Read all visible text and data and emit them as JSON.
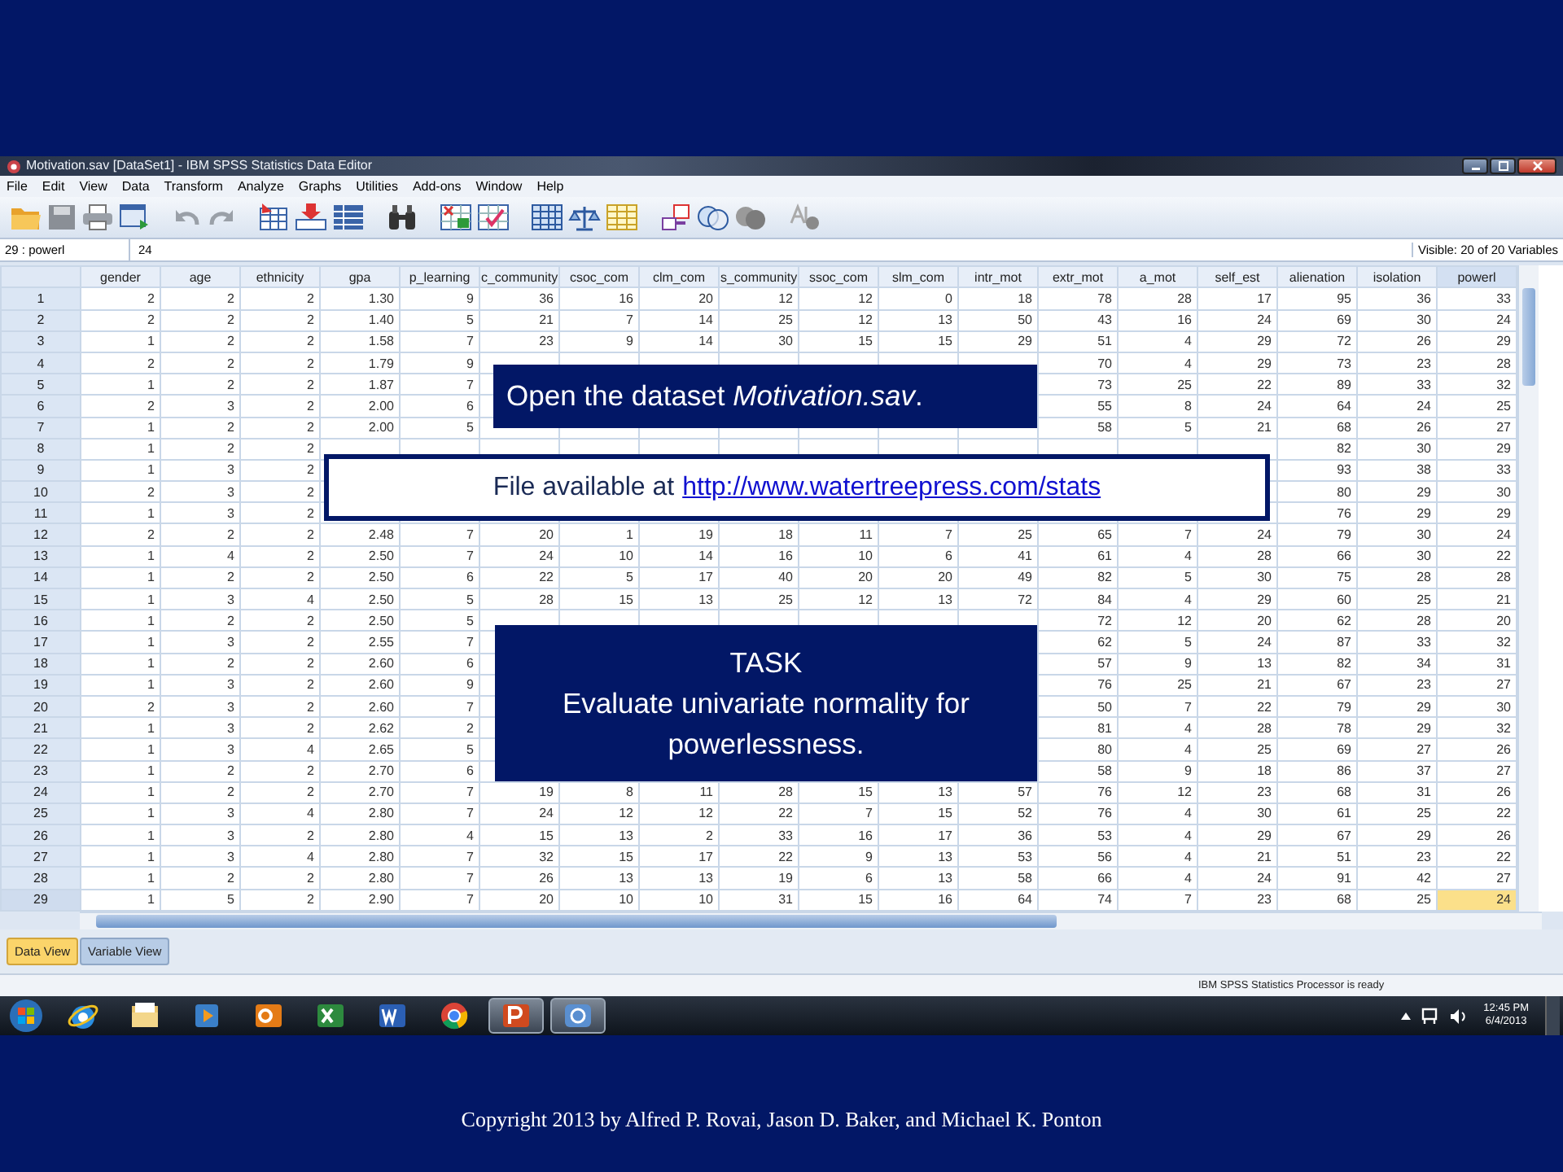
{
  "window": {
    "title": "Motivation.sav [DataSet1] - IBM SPSS Statistics Data Editor"
  },
  "menu": [
    "File",
    "Edit",
    "View",
    "Data",
    "Transform",
    "Analyze",
    "Graphs",
    "Utilities",
    "Add-ons",
    "Window",
    "Help"
  ],
  "cell_editor": {
    "cell": "29 : powerl",
    "value": "24",
    "visible": "Visible: 20 of 20 Variables"
  },
  "table": {
    "columns": [
      {
        "name": "gender",
        "selected": false
      },
      {
        "name": "age",
        "selected": false
      },
      {
        "name": "ethnicity",
        "selected": false
      },
      {
        "name": "gpa",
        "selected": false
      },
      {
        "name": "p_learning",
        "selected": false
      },
      {
        "name": "c_community",
        "selected": false
      },
      {
        "name": "csoc_com",
        "selected": false
      },
      {
        "name": "clm_com",
        "selected": false
      },
      {
        "name": "s_community",
        "selected": false
      },
      {
        "name": "ssoc_com",
        "selected": false
      },
      {
        "name": "slm_com",
        "selected": false
      },
      {
        "name": "intr_mot",
        "selected": false
      },
      {
        "name": "extr_mot",
        "selected": false
      },
      {
        "name": "a_mot",
        "selected": false
      },
      {
        "name": "self_est",
        "selected": false
      },
      {
        "name": "alienation",
        "selected": false
      },
      {
        "name": "isolation",
        "selected": false
      },
      {
        "name": "powerl",
        "selected": true
      }
    ],
    "rows": [
      {
        "number": "1",
        "selected": false,
        "cells": [
          "2",
          "2",
          "2",
          "1.30",
          "9",
          "36",
          "16",
          "20",
          "12",
          "12",
          "0",
          "18",
          "78",
          "28",
          "17",
          "95",
          "36",
          "33"
        ]
      },
      {
        "number": "2",
        "selected": false,
        "cells": [
          "2",
          "2",
          "2",
          "1.40",
          "5",
          "21",
          "7",
          "14",
          "25",
          "12",
          "13",
          "50",
          "43",
          "16",
          "24",
          "69",
          "30",
          "24"
        ]
      },
      {
        "number": "3",
        "selected": false,
        "cells": [
          "1",
          "2",
          "2",
          "1.58",
          "7",
          "23",
          "9",
          "14",
          "30",
          "15",
          "15",
          "29",
          "51",
          "4",
          "29",
          "72",
          "26",
          "29"
        ]
      },
      {
        "number": "4",
        "selected": false,
        "cells": [
          "2",
          "2",
          "2",
          "1.79",
          "9",
          null,
          null,
          null,
          null,
          null,
          null,
          null,
          "70",
          "4",
          "29",
          "73",
          "23",
          "28"
        ]
      },
      {
        "number": "5",
        "selected": false,
        "cells": [
          "1",
          "2",
          "2",
          "1.87",
          "7",
          null,
          null,
          null,
          null,
          null,
          null,
          null,
          "73",
          "25",
          "22",
          "89",
          "33",
          "32"
        ]
      },
      {
        "number": "6",
        "selected": false,
        "cells": [
          "2",
          "3",
          "2",
          "2.00",
          "6",
          null,
          null,
          null,
          null,
          null,
          null,
          null,
          "55",
          "8",
          "24",
          "64",
          "24",
          "25"
        ]
      },
      {
        "number": "7",
        "selected": false,
        "cells": [
          "1",
          "2",
          "2",
          "2.00",
          "5",
          null,
          null,
          null,
          null,
          null,
          null,
          null,
          "58",
          "5",
          "21",
          "68",
          "26",
          "27"
        ]
      },
      {
        "number": "8",
        "selected": false,
        "cells": [
          "1",
          "2",
          "2",
          null,
          null,
          null,
          null,
          null,
          null,
          null,
          null,
          null,
          null,
          null,
          null,
          "82",
          "30",
          "29"
        ]
      },
      {
        "number": "9",
        "selected": false,
        "cells": [
          "1",
          "3",
          "2",
          null,
          null,
          null,
          null,
          null,
          null,
          null,
          null,
          null,
          null,
          null,
          null,
          "93",
          "38",
          "33"
        ]
      },
      {
        "number": "10",
        "selected": false,
        "cells": [
          "2",
          "3",
          "2",
          null,
          null,
          null,
          null,
          null,
          null,
          null,
          null,
          null,
          null,
          null,
          null,
          "80",
          "29",
          "30"
        ]
      },
      {
        "number": "11",
        "selected": false,
        "cells": [
          "1",
          "3",
          "2",
          null,
          null,
          null,
          null,
          null,
          null,
          null,
          null,
          null,
          null,
          null,
          null,
          "76",
          "29",
          "29"
        ]
      },
      {
        "number": "12",
        "selected": false,
        "cells": [
          "2",
          "2",
          "2",
          "2.48",
          "7",
          "20",
          "1",
          "19",
          "18",
          "11",
          "7",
          "25",
          "65",
          "7",
          "24",
          "79",
          "30",
          "24"
        ]
      },
      {
        "number": "13",
        "selected": false,
        "cells": [
          "1",
          "4",
          "2",
          "2.50",
          "7",
          "24",
          "10",
          "14",
          "16",
          "10",
          "6",
          "41",
          "61",
          "4",
          "28",
          "66",
          "30",
          "22"
        ]
      },
      {
        "number": "14",
        "selected": false,
        "cells": [
          "1",
          "2",
          "2",
          "2.50",
          "6",
          "22",
          "5",
          "17",
          "40",
          "20",
          "20",
          "49",
          "82",
          "5",
          "30",
          "75",
          "28",
          "28"
        ]
      },
      {
        "number": "15",
        "selected": false,
        "cells": [
          "1",
          "3",
          "4",
          "2.50",
          "5",
          "28",
          "15",
          "13",
          "25",
          "12",
          "13",
          "72",
          "84",
          "4",
          "29",
          "60",
          "25",
          "21"
        ]
      },
      {
        "number": "16",
        "selected": false,
        "cells": [
          "1",
          "2",
          "2",
          "2.50",
          "5",
          null,
          null,
          null,
          null,
          null,
          null,
          null,
          "72",
          "12",
          "20",
          "62",
          "28",
          "20"
        ]
      },
      {
        "number": "17",
        "selected": false,
        "cells": [
          "1",
          "3",
          "2",
          "2.55",
          "7",
          null,
          null,
          null,
          null,
          null,
          null,
          null,
          "62",
          "5",
          "24",
          "87",
          "33",
          "32"
        ]
      },
      {
        "number": "18",
        "selected": false,
        "cells": [
          "1",
          "2",
          "2",
          "2.60",
          "6",
          null,
          null,
          null,
          null,
          null,
          null,
          null,
          "57",
          "9",
          "13",
          "82",
          "34",
          "31"
        ]
      },
      {
        "number": "19",
        "selected": false,
        "cells": [
          "1",
          "3",
          "2",
          "2.60",
          "9",
          null,
          null,
          null,
          null,
          null,
          null,
          null,
          "76",
          "25",
          "21",
          "67",
          "23",
          "27"
        ]
      },
      {
        "number": "20",
        "selected": false,
        "cells": [
          "2",
          "3",
          "2",
          "2.60",
          "7",
          null,
          null,
          null,
          null,
          null,
          null,
          null,
          "50",
          "7",
          "22",
          "79",
          "29",
          "30"
        ]
      },
      {
        "number": "21",
        "selected": false,
        "cells": [
          "1",
          "3",
          "2",
          "2.62",
          "2",
          null,
          null,
          null,
          null,
          null,
          null,
          null,
          "81",
          "4",
          "28",
          "78",
          "29",
          "32"
        ]
      },
      {
        "number": "22",
        "selected": false,
        "cells": [
          "1",
          "3",
          "4",
          "2.65",
          "5",
          null,
          null,
          null,
          null,
          null,
          null,
          null,
          "80",
          "4",
          "25",
          "69",
          "27",
          "26"
        ]
      },
      {
        "number": "23",
        "selected": false,
        "cells": [
          "1",
          "2",
          "2",
          "2.70",
          "6",
          null,
          null,
          null,
          null,
          null,
          null,
          null,
          "58",
          "9",
          "18",
          "86",
          "37",
          "27"
        ]
      },
      {
        "number": "24",
        "selected": false,
        "cells": [
          "1",
          "2",
          "2",
          "2.70",
          "7",
          "19",
          "8",
          "11",
          "28",
          "15",
          "13",
          "57",
          "76",
          "12",
          "23",
          "68",
          "31",
          "26"
        ]
      },
      {
        "number": "25",
        "selected": false,
        "cells": [
          "1",
          "3",
          "4",
          "2.80",
          "7",
          "24",
          "12",
          "12",
          "22",
          "7",
          "15",
          "52",
          "76",
          "4",
          "30",
          "61",
          "25",
          "22"
        ]
      },
      {
        "number": "26",
        "selected": false,
        "cells": [
          "1",
          "3",
          "2",
          "2.80",
          "4",
          "15",
          "13",
          "2",
          "33",
          "16",
          "17",
          "36",
          "53",
          "4",
          "29",
          "67",
          "29",
          "26"
        ]
      },
      {
        "number": "27",
        "selected": false,
        "cells": [
          "1",
          "3",
          "4",
          "2.80",
          "7",
          "32",
          "15",
          "17",
          "22",
          "9",
          "13",
          "53",
          "56",
          "4",
          "21",
          "51",
          "23",
          "22"
        ]
      },
      {
        "number": "28",
        "selected": false,
        "cells": [
          "1",
          "2",
          "2",
          "2.80",
          "7",
          "26",
          "13",
          "13",
          "19",
          "6",
          "13",
          "58",
          "66",
          "4",
          "24",
          "91",
          "42",
          "27"
        ]
      },
      {
        "number": "29",
        "selected": true,
        "cells": [
          "1",
          "5",
          "2",
          "2.90",
          "7",
          "20",
          "10",
          "10",
          "31",
          "15",
          "16",
          "64",
          "74",
          "7",
          "23",
          "68",
          "25",
          "24"
        ]
      }
    ]
  },
  "view_tabs": [
    {
      "label": "Data View",
      "selected": true
    },
    {
      "label": "Variable View",
      "selected": false
    }
  ],
  "status_bar": "IBM SPSS Statistics Processor is ready",
  "taskbar": {
    "buttons": [
      {
        "kind": "ie",
        "active": false
      },
      {
        "kind": "explorer",
        "active": false
      },
      {
        "kind": "media",
        "active": false
      },
      {
        "kind": "outlook",
        "active": false
      },
      {
        "kind": "excel",
        "active": false
      },
      {
        "kind": "word",
        "active": false
      },
      {
        "kind": "chrome",
        "active": false
      },
      {
        "kind": "powerpoint",
        "active": true
      },
      {
        "kind": "spss",
        "active": true
      }
    ],
    "time": "12:45 PM",
    "date": "6/4/2013"
  },
  "slide": {
    "callouts": [
      {
        "kind": "instruction",
        "text": "Open the dataset *Motivation.sav*."
      },
      {
        "kind": "link",
        "text": "File available at",
        "link": "http://www.watertreepress.com/stats"
      },
      {
        "kind": "task",
        "heading": "TASK",
        "text": "Evaluate univariate normality for powerlessness."
      }
    ],
    "footer": "Copyright 2013 by Alfred P. Rovai, Jason D. Baker, and Michael K. Ponton"
  }
}
